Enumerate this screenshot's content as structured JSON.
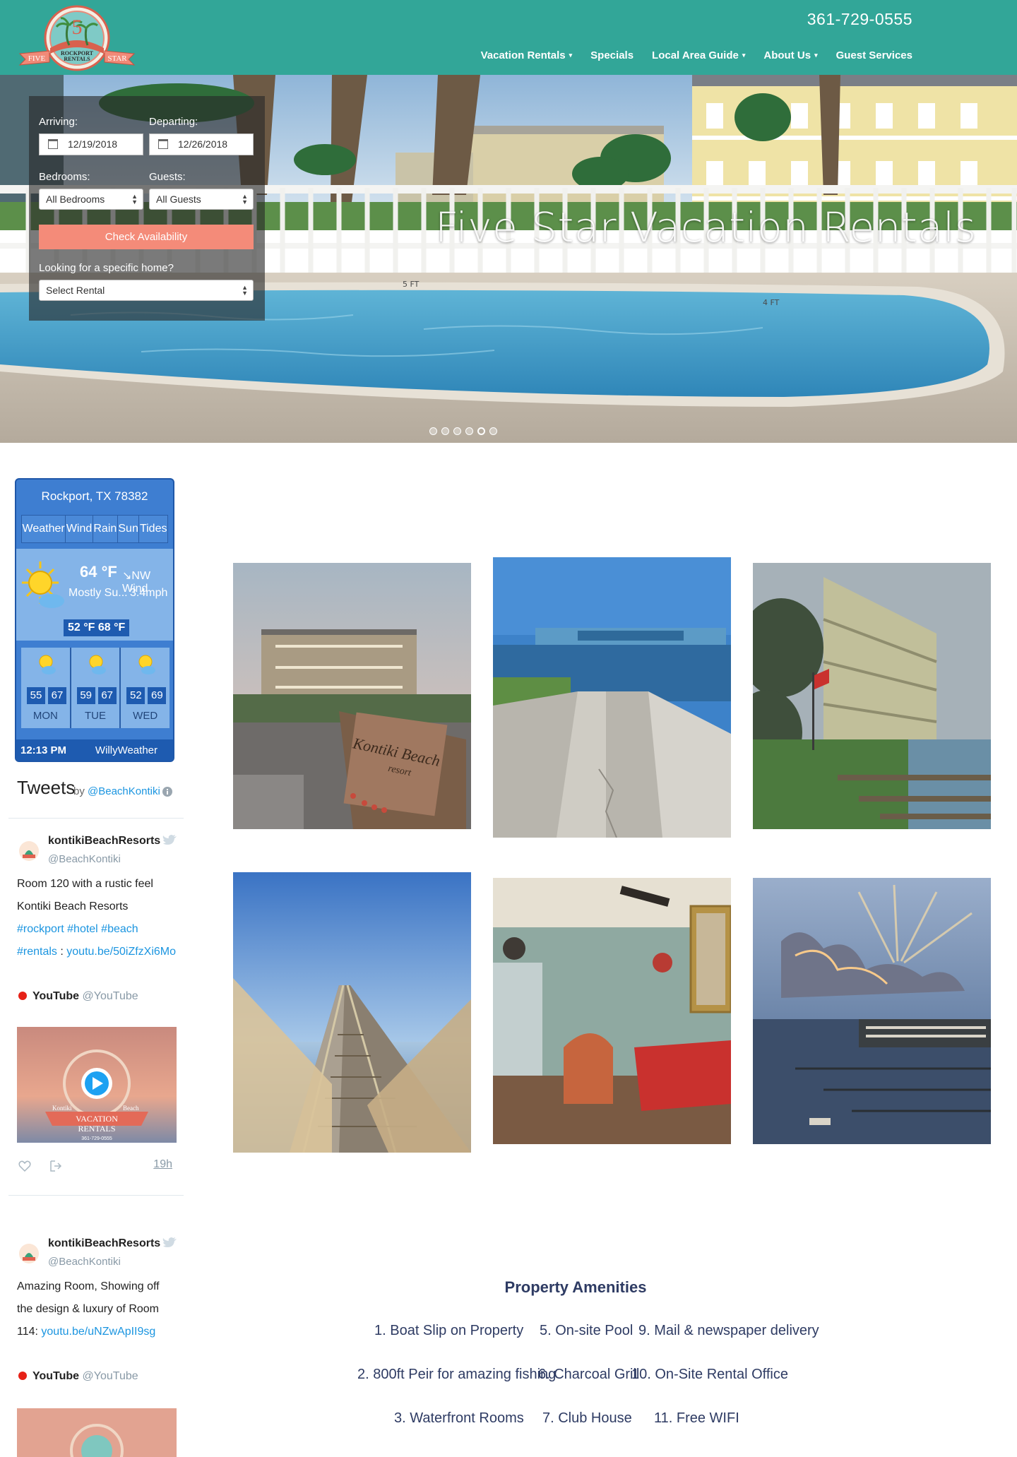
{
  "header": {
    "phone": "361-729-0555",
    "logo_text": [
      "FIVE",
      "STAR",
      "ROCKPORT",
      "RENTALS",
      "5"
    ],
    "nav": [
      {
        "label": "Vacation Rentals",
        "has_caret": true
      },
      {
        "label": "Specials",
        "has_caret": false
      },
      {
        "label": "Local Area Guide",
        "has_caret": true
      },
      {
        "label": "About Us",
        "has_caret": true
      },
      {
        "label": "Guest Services",
        "has_caret": false
      }
    ],
    "caret_glyph": "▾"
  },
  "hero": {
    "title": "Five Star Vacation Rentals",
    "slides": 6,
    "active_slide": 5,
    "pool_depth_marks": [
      "5 FT",
      "4 FT"
    ]
  },
  "search": {
    "arriving_label": "Arriving:",
    "arriving_value": "12/19/2018",
    "departing_label": "Departing:",
    "departing_value": "12/26/2018",
    "bedrooms_label": "Bedrooms:",
    "bedrooms_value": "All Bedrooms",
    "guests_label": "Guests:",
    "guests_value": "All Guests",
    "check_button": "Check Availability",
    "specific_label": "Looking for a specific home?",
    "rental_value": "Select Rental"
  },
  "weather": {
    "city": "Rockport, TX 78382",
    "tabs": [
      "Weather",
      "Wind",
      "Rain",
      "Sun",
      "Tides"
    ],
    "temp": "64 °F",
    "condition": "Mostly Su...",
    "wind_dir": "NW Wind",
    "wind_speed": "3.4mph",
    "lohi": "52 °F   68 °F",
    "days": [
      {
        "name": "MON",
        "lo": "55",
        "hi": "67"
      },
      {
        "name": "TUE",
        "lo": "59",
        "hi": "67"
      },
      {
        "name": "WED",
        "lo": "52",
        "hi": "69"
      }
    ],
    "time": "12:13 PM",
    "brand": "WillyWeather"
  },
  "tweets": {
    "title": "Tweets",
    "by": "by",
    "handle": "@BeachKontiki",
    "items": [
      {
        "name": "kontikiBeachResorts",
        "user": "@BeachKontiki",
        "text": "Room 120 with a rustic feel Kontiki Beach Resorts ",
        "tags": "#rockport #hotel #beach #rentals",
        "sep": " :",
        "link": "youtu.be/50iZfzXi6Mo",
        "yt_name": "YouTube",
        "yt_handle": "@YouTube",
        "time": "19h",
        "card_text": [
          "VACATION",
          "RENTALS",
          "Kontiki",
          "Beach",
          "361-729-0555"
        ]
      },
      {
        "name": "kontikiBeachResorts",
        "user": "@BeachKontiki",
        "text": "Amazing Room, Showing off the design & luxury of Room 114: ",
        "link": "youtu.be/uNZwApII9sg",
        "yt_name": "YouTube",
        "yt_handle": "@YouTube"
      }
    ]
  },
  "gallery": {
    "sign_text": [
      "Kontiki Beach",
      "resort"
    ]
  },
  "amenities": {
    "title": "Property Amenities",
    "items": [
      "1.  Boat Slip on Property",
      "5. On-site Pool",
      "9. Mail & newspaper delivery",
      "2. 800ft Peir for amazing fishing",
      "6. Charcoal Grill",
      "10. On-Site Rental Office",
      "3. Waterfront Rooms",
      "7. Club House",
      "11. Free WIFI"
    ]
  },
  "colors": {
    "header_bg": "#32a698",
    "button": "#f48b79",
    "amenity_text": "#2e3b63",
    "weather_blue": "#3e7ed1"
  }
}
